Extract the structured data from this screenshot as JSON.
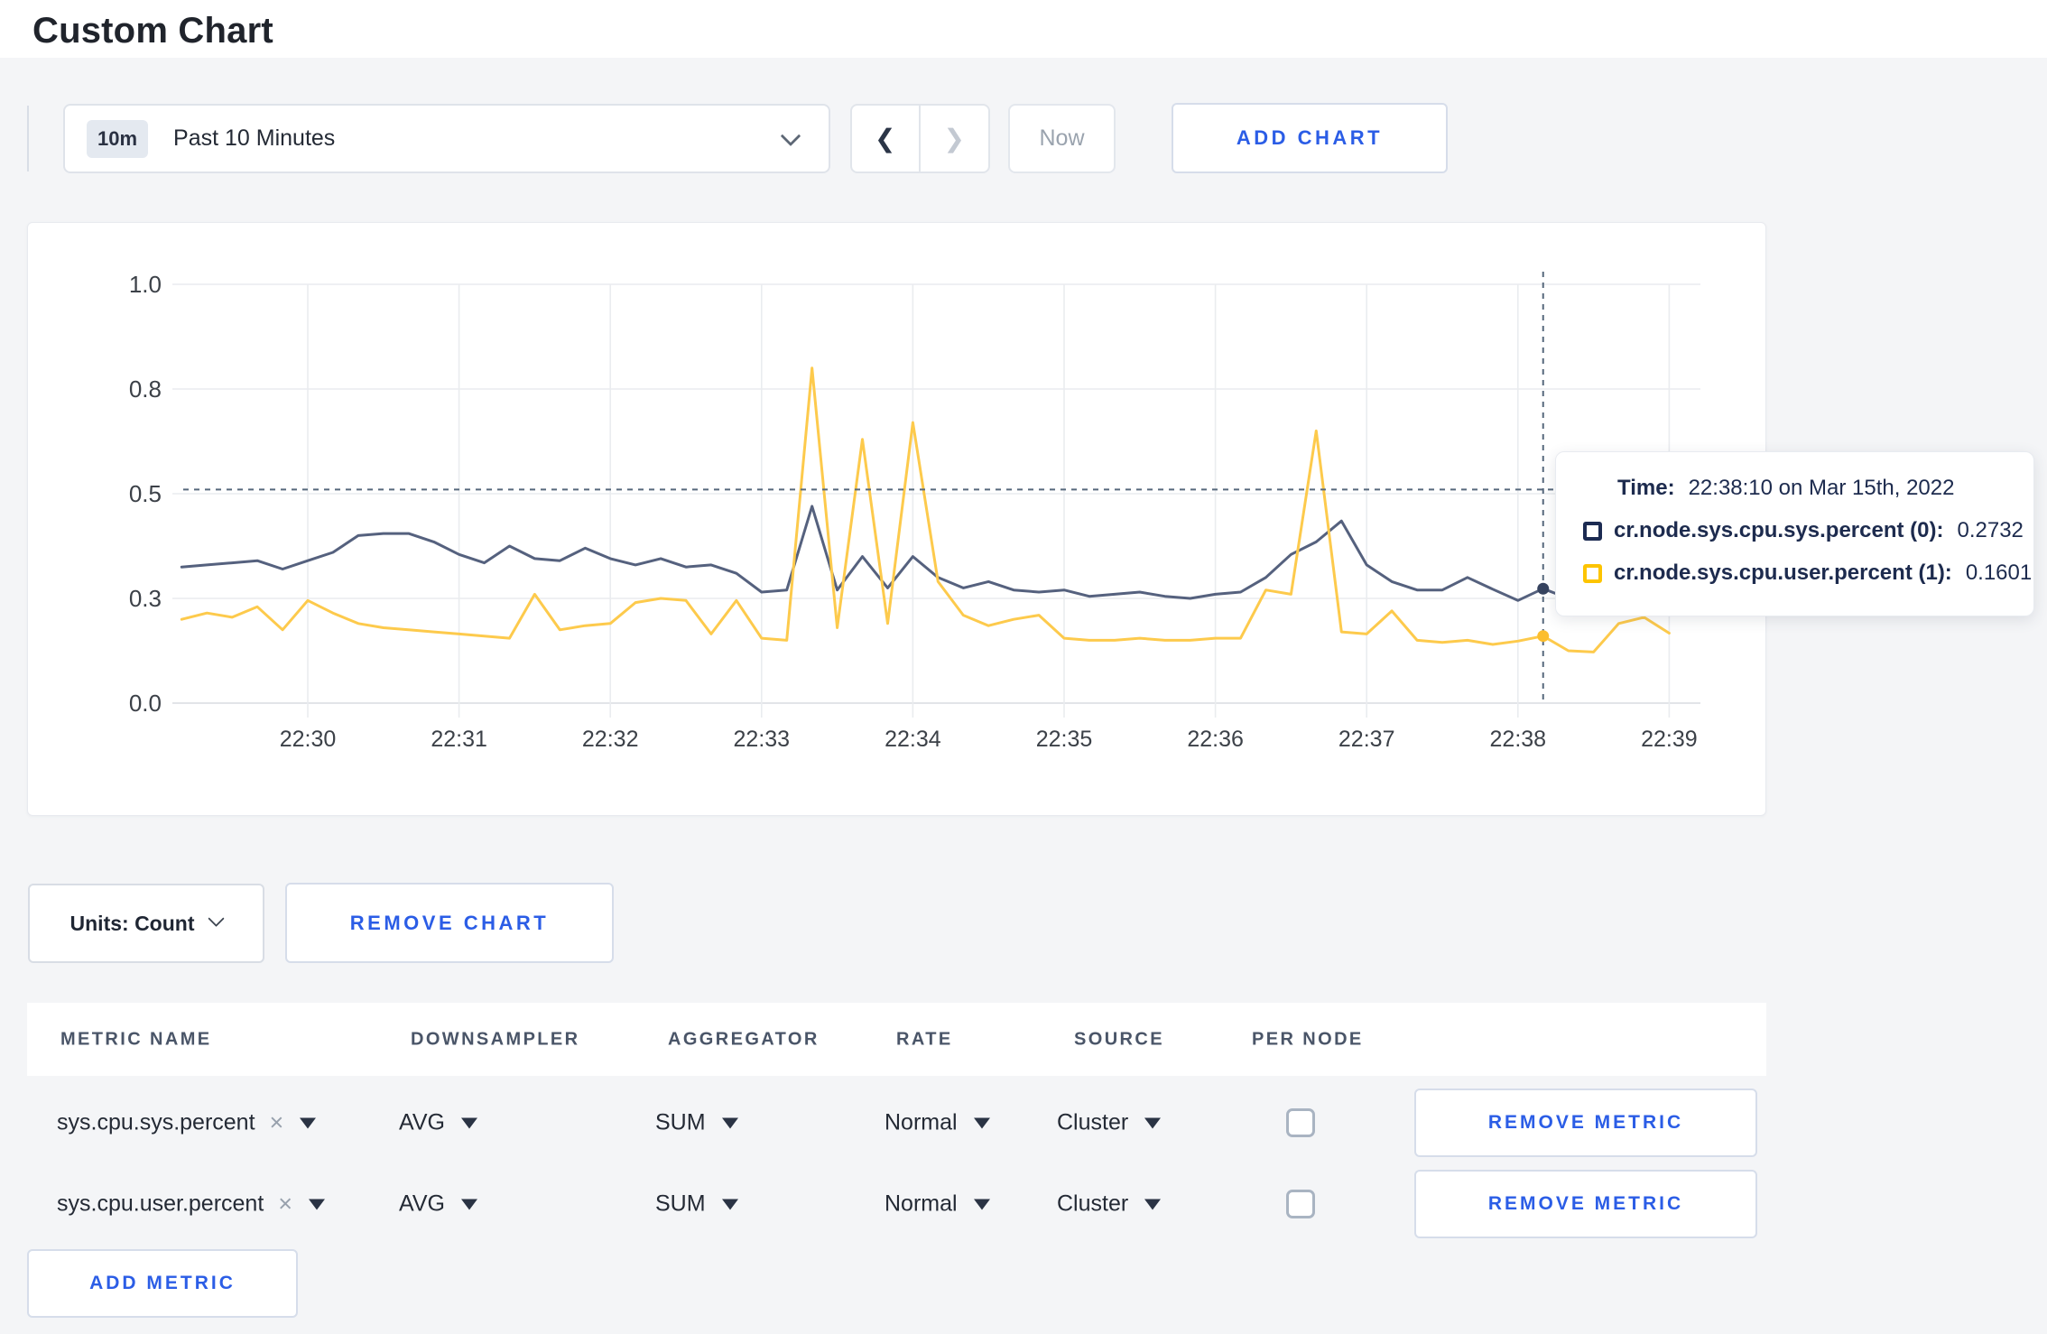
{
  "page": {
    "title": "Custom Chart"
  },
  "icons": {
    "chevron_left": "❮",
    "chevron_right": "❯",
    "close": "×"
  },
  "toolbar": {
    "time_range_badge": "10m",
    "time_range_label": "Past 10 Minutes",
    "now_label": "Now",
    "add_chart_label": "ADD CHART"
  },
  "chart_data": {
    "type": "line",
    "title": "",
    "xlabel": "",
    "ylabel": "",
    "ylim": [
      0,
      1
    ],
    "grid": true,
    "x_tick_labels": [
      "22:30",
      "22:31",
      "22:32",
      "22:33",
      "22:34",
      "22:35",
      "22:36",
      "22:37",
      "22:38",
      "22:39"
    ],
    "y_tick_labels": [
      "0.0",
      "0.3",
      "0.5",
      "0.8",
      "1.0"
    ],
    "y_tick_values": [
      0,
      0.25,
      0.5,
      0.75,
      1.0
    ],
    "start_time": "22:29:10",
    "interval_seconds": 10,
    "series": [
      {
        "name": "cr.node.sys.cpu.sys.percent",
        "color": "#55617e",
        "values": [
          0.325,
          0.33,
          0.335,
          0.34,
          0.32,
          0.34,
          0.36,
          0.4,
          0.405,
          0.405,
          0.385,
          0.355,
          0.335,
          0.375,
          0.345,
          0.34,
          0.37,
          0.345,
          0.33,
          0.345,
          0.325,
          0.33,
          0.31,
          0.265,
          0.27,
          0.47,
          0.27,
          0.35,
          0.275,
          0.35,
          0.3,
          0.275,
          0.29,
          0.27,
          0.265,
          0.27,
          0.255,
          0.26,
          0.265,
          0.255,
          0.25,
          0.26,
          0.265,
          0.3,
          0.355,
          0.385,
          0.435,
          0.33,
          0.29,
          0.27,
          0.27,
          0.3,
          0.272,
          0.245,
          0.2732,
          0.25,
          0.26,
          0.27,
          0.265,
          0.27
        ]
      },
      {
        "name": "cr.node.sys.cpu.user.percent",
        "color": "#fdca4c",
        "values": [
          0.2,
          0.215,
          0.205,
          0.23,
          0.175,
          0.245,
          0.215,
          0.19,
          0.18,
          0.175,
          0.17,
          0.165,
          0.16,
          0.155,
          0.26,
          0.175,
          0.185,
          0.19,
          0.24,
          0.25,
          0.245,
          0.165,
          0.245,
          0.155,
          0.15,
          0.8,
          0.18,
          0.63,
          0.19,
          0.67,
          0.29,
          0.21,
          0.185,
          0.2,
          0.21,
          0.155,
          0.15,
          0.15,
          0.155,
          0.15,
          0.15,
          0.155,
          0.155,
          0.27,
          0.26,
          0.65,
          0.17,
          0.165,
          0.22,
          0.15,
          0.145,
          0.15,
          0.14,
          0.148,
          0.1601,
          0.125,
          0.122,
          0.19,
          0.205,
          0.167
        ]
      }
    ],
    "crosshair": {
      "time": "22:38:10",
      "y_value": 0.51
    },
    "hover": {
      "time_title": "Time:",
      "time_value": "22:38:10 on Mar 15th, 2022",
      "points": [
        {
          "series": 0,
          "label": "cr.node.sys.cpu.sys.percent (0):",
          "value": "0.2732",
          "swatch": "#1c2b52",
          "dot_color": "#36435f",
          "dot_value": 0.2732
        },
        {
          "series": 1,
          "label": "cr.node.sys.cpu.user.percent (1):",
          "value": "0.1601",
          "swatch": "#fdc400",
          "dot_color": "#fcbe2d",
          "dot_value": 0.1601
        }
      ]
    }
  },
  "units_bar": {
    "units_label": "Units: Count",
    "remove_chart_label": "REMOVE CHART"
  },
  "metrics_table": {
    "headers": [
      "METRIC NAME",
      "DOWNSAMPLER",
      "AGGREGATOR",
      "RATE",
      "SOURCE",
      "PER NODE"
    ],
    "rows": [
      {
        "metric_name": "sys.cpu.sys.percent",
        "downsampler": "AVG",
        "aggregator": "SUM",
        "rate": "Normal",
        "source": "Cluster",
        "per_node_checked": false
      },
      {
        "metric_name": "sys.cpu.user.percent",
        "downsampler": "AVG",
        "aggregator": "SUM",
        "rate": "Normal",
        "source": "Cluster",
        "per_node_checked": false
      }
    ],
    "remove_metric_label": "REMOVE METRIC",
    "add_metric_label": "ADD METRIC"
  },
  "colors": {
    "accent_blue": "#2b5de6",
    "grid_line": "#eaecef",
    "axis_line": "#d8dbe0",
    "crosshair": "#56687c",
    "tooltip_text": "#1d2b4e"
  }
}
